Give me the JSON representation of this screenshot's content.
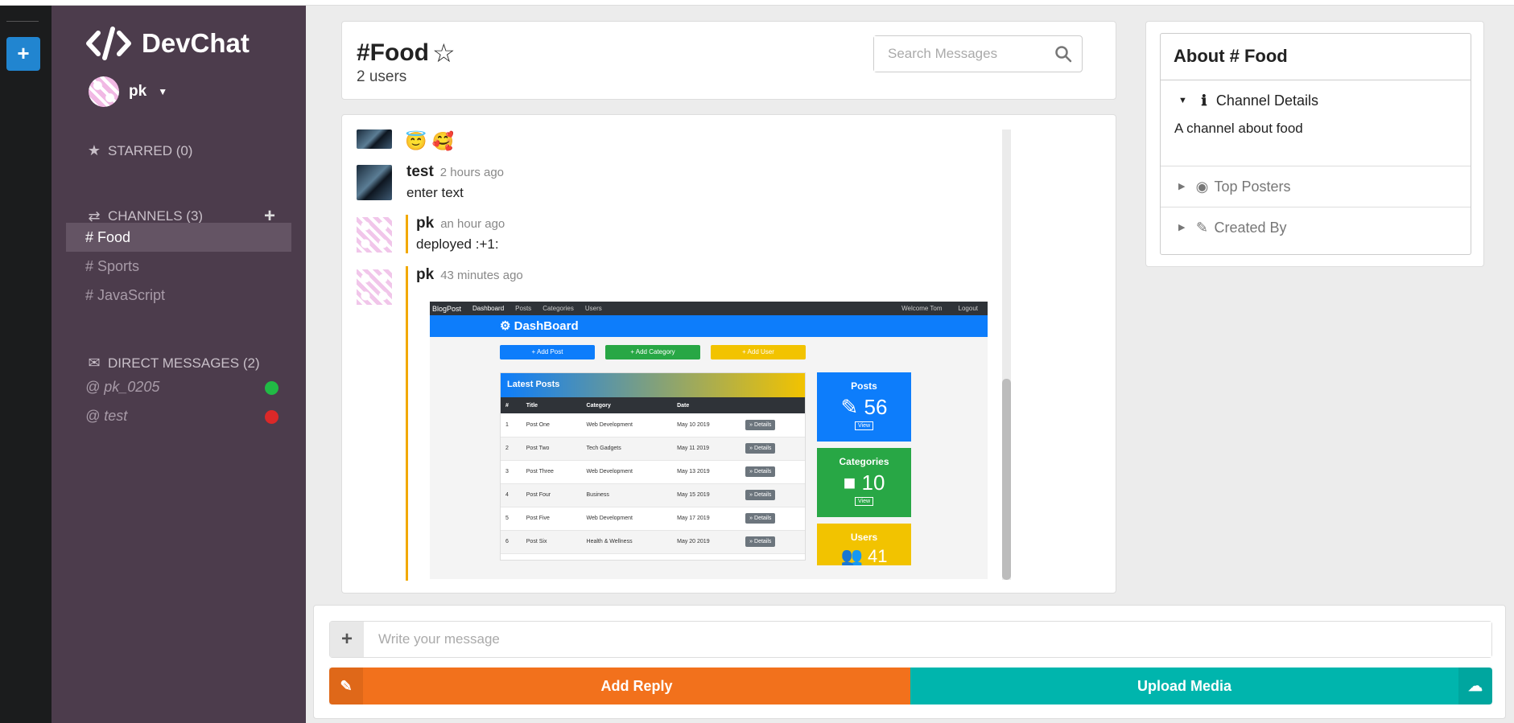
{
  "app": {
    "name": "DevChat",
    "accent": "#2185d0"
  },
  "user": {
    "name": "pk"
  },
  "sidebar": {
    "starred_label": "STARRED (0)",
    "channels_label": "CHANNELS (3)",
    "channels": [
      "# Food",
      "# Sports",
      "# JavaScript"
    ],
    "dm_label": "DIRECT MESSAGES (2)",
    "direct_messages": [
      {
        "name": "@ pk_0205",
        "status_color": "#21ba45"
      },
      {
        "name": "@ test",
        "status_color": "#db2828"
      }
    ]
  },
  "header": {
    "channel_title": "#Food",
    "user_count": "2 users",
    "search_placeholder": "Search Messages"
  },
  "messages": [
    {
      "emoji": "😇 🥰"
    },
    {
      "author": "test",
      "time": "2 hours ago",
      "text": "enter text"
    },
    {
      "author": "pk",
      "time": "an hour ago",
      "text": "deployed :+1:"
    },
    {
      "author": "pk",
      "time": "43 minutes ago"
    }
  ],
  "dashboard_image": {
    "nav_brand": "BlogPost",
    "nav_items": [
      "Dashboard",
      "Posts",
      "Categories",
      "Users"
    ],
    "nav_right": [
      "Welcome Tom",
      "Logout"
    ],
    "banner": "⚙ DashBoard",
    "buttons": [
      "+ Add Post",
      "+ Add Category",
      "+ Add User"
    ],
    "latest_title": "Latest Posts",
    "table_headers": [
      "#",
      "Title",
      "Category",
      "Date",
      ""
    ],
    "rows": [
      [
        "1",
        "Post One",
        "Web Development",
        "May 10 2019",
        "» Details"
      ],
      [
        "2",
        "Post Two",
        "Tech Gadgets",
        "May 11 2019",
        "» Details"
      ],
      [
        "3",
        "Post Three",
        "Web Development",
        "May 13 2019",
        "» Details"
      ],
      [
        "4",
        "Post Four",
        "Business",
        "May 15 2019",
        "» Details"
      ],
      [
        "5",
        "Post Five",
        "Web Development",
        "May 17 2019",
        "» Details"
      ],
      [
        "6",
        "Post Six",
        "Health & Wellness",
        "May 20 2019",
        "» Details"
      ]
    ],
    "stats": [
      {
        "label": "Posts",
        "value": "✎ 56",
        "view": "View",
        "color": "#0d7dfb"
      },
      {
        "label": "Categories",
        "value": "■ 10",
        "view": "View",
        "color": "#28a745"
      },
      {
        "label": "Users",
        "value": "👥 41",
        "view": "",
        "color": "#f2c300"
      }
    ]
  },
  "about": {
    "title": "About # Food",
    "channel_details_label": "Channel Details",
    "channel_description": "A channel about food",
    "top_posters_label": "Top Posters",
    "created_by_label": "Created By"
  },
  "composer": {
    "placeholder": "Write your message",
    "reply_label": "Add Reply",
    "upload_label": "Upload Media",
    "reply_color": "#f2711c",
    "upload_color": "#00b5ad"
  }
}
